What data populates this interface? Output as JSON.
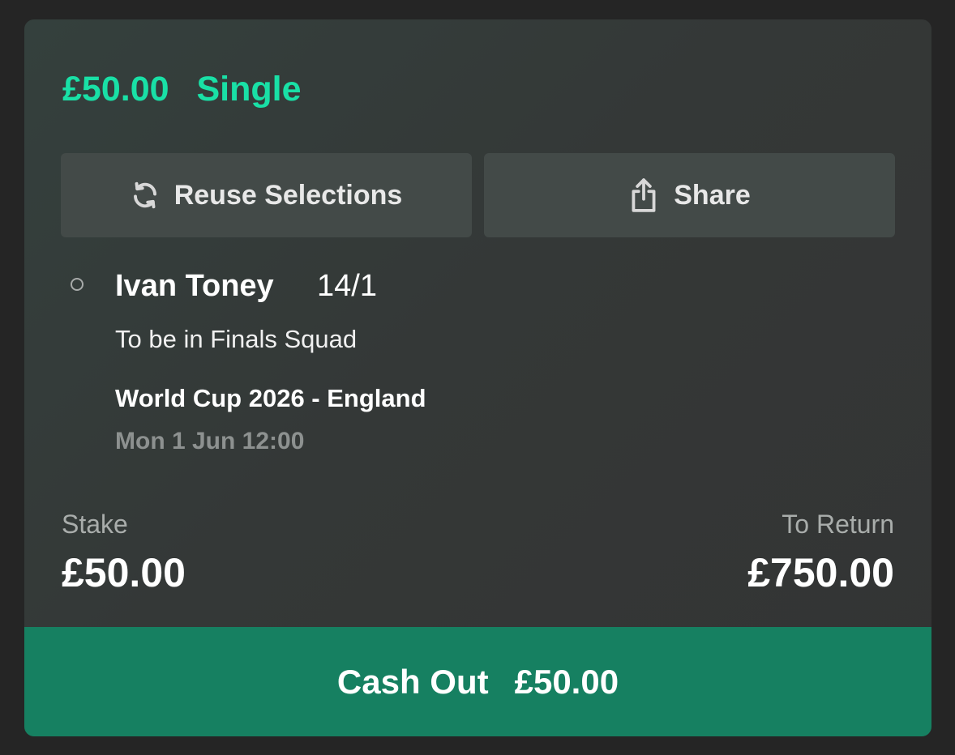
{
  "bet": {
    "amount": "£50.00",
    "type": "Single"
  },
  "actions": {
    "reuse_label": "Reuse Selections",
    "reuse_icon": "refresh-icon",
    "share_label": "Share",
    "share_icon": "share-icon"
  },
  "selection": {
    "name": "Ivan Toney",
    "odds": "14/1",
    "market": "To be in Finals Squad",
    "event": "World Cup 2026 - England",
    "datetime": "Mon 1 Jun 12:00"
  },
  "totals": {
    "stake_label": "Stake",
    "stake_value": "£50.00",
    "return_label": "To Return",
    "return_value": "£750.00"
  },
  "cashout": {
    "label": "Cash Out",
    "amount": "£50.00"
  },
  "colors": {
    "accent": "#19e0a6",
    "cashout_bg": "#168061",
    "button_bg": "#434a48",
    "card_bg": "#343837"
  }
}
